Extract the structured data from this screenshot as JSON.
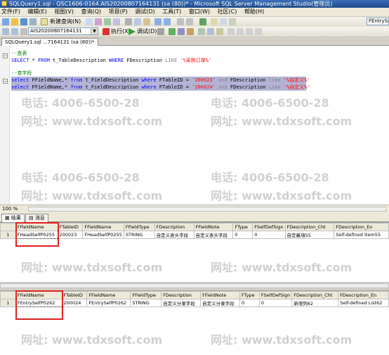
{
  "window": {
    "title": "SQLQuery1.sql - QSC1606-0164.AIS20200807164131 (sa (80))* - Microsoft SQL Server Management Studio(管理员)"
  },
  "menu": [
    "文件(F)",
    "编辑(E)",
    "视图(V)",
    "查询(Q)",
    "项目(P)",
    "调试(D)",
    "工具(T)",
    "窗口(W)",
    "社区(C)",
    "帮助(H)"
  ],
  "toolbar1": {
    "new_query": "新建查询(N)",
    "right_combo": "FEntrySel"
  },
  "toolbar2": {
    "database": "AIS20200807164131",
    "execute": "执行(X)",
    "debug": "调试(D)"
  },
  "document_tab": "SQLQuery1.sql ...7164131 (sa (80))*",
  "editor": {
    "lines": [
      {
        "part1": "--查表"
      },
      {
        "kw1": "SELECT",
        "t1": " * ",
        "kw2": "FROM",
        "t2": " t_TableDescription ",
        "kw3": "WHERE",
        "t3": " FDescription ",
        "kw4": "LIKE",
        "str": " '%采购订单%'"
      },
      {
        "part1": "--查字段"
      },
      {
        "kw1": "select",
        "t1": " FFieldName,* ",
        "kw2": "from",
        "t2": " t_FieldDescription ",
        "kw3": "where",
        "t3": " FTableID = ",
        "str": "'200023'",
        "kw4": " and",
        "t4": " FDescription ",
        "kw5": "like",
        "str2": " '%自定义%'"
      },
      {
        "kw1": "select",
        "t1": " FFieldName,* ",
        "kw2": "from",
        "t2": " t_FieldDescription ",
        "kw3": "where",
        "t3": " FTableID = ",
        "str": "'200024'",
        "kw4": " and",
        "t4": " FDescription ",
        "kw5": "Like",
        "str2": " '%自定义%'"
      }
    ]
  },
  "watermark": {
    "phone": "电话: 4006-6500-28",
    "site": "网址: www.tdxsoft.com"
  },
  "status": {
    "zoom": "100 %"
  },
  "result_tabs": {
    "results": "结果",
    "messages": "消息"
  },
  "grid1": {
    "columns": [
      "FFieldName",
      "FTableID",
      "FFieldName",
      "FFieldType",
      "FDescription",
      "FFieldNote",
      "FType",
      "FSelfDefSign",
      "FDescription_Cht",
      "FDescription_En"
    ],
    "rows": [
      [
        "1",
        "FHeadSelfP0255",
        "200023",
        "FHeadSelfP0255",
        "STRING",
        "自定义表头字段",
        "自定义表头字段",
        "0",
        "0",
        "自定義項55",
        "Self-defined Item55"
      ]
    ]
  },
  "grid2": {
    "columns": [
      "FFieldName",
      "FTableID",
      "FFieldName",
      "FFieldType",
      "FDescription",
      "FFieldNote",
      "FType",
      "FSelfDefSign",
      "FDescription_Cht",
      "FDescription_En"
    ],
    "rows": [
      [
        "1",
        "FEntrySelfP0262",
        "200024",
        "FEntrySelfP0262",
        "STRING",
        "自定义分录字段",
        "自定义分录字段",
        "0",
        "0",
        "新增列62",
        "Self-defined List62"
      ]
    ]
  },
  "colors": {
    "title_bar": "#1e4a8c",
    "selection": "#b3b3d6",
    "highlight_box": "#e02020"
  }
}
